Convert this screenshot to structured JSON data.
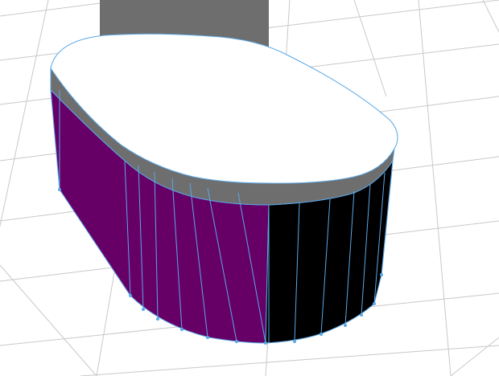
{
  "viewport": {
    "background": "#ffffff",
    "grid_color": "#c8c8c8",
    "selection_color": "#5aa7e6"
  },
  "scene": {
    "objects": [
      {
        "name": "background-block",
        "color": "#6e6e6e"
      },
      {
        "name": "pill-shape",
        "top_color": "#ffffff",
        "rim_color": "#6e6e6e",
        "side_left_color": "#660066",
        "side_right_color": "#000000"
      }
    ]
  }
}
